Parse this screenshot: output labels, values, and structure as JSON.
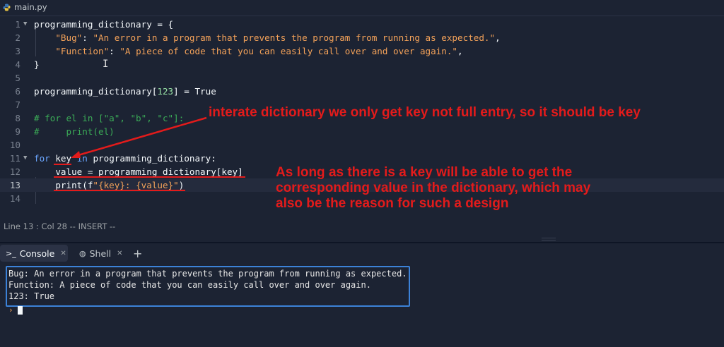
{
  "file_tab": {
    "filename": "main.py",
    "icon": "python-icon"
  },
  "editor": {
    "lines": [
      {
        "n": "1",
        "t": "programming_dictionary = {"
      },
      {
        "n": "2",
        "key": "\"Bug\"",
        "val": "\"An error in a program that prevents the program from running as expected.\""
      },
      {
        "n": "3",
        "key": "\"Function\"",
        "val": "\"A piece of code that you can easily call over and over again.\""
      },
      {
        "n": "4",
        "t": "}"
      },
      {
        "n": "5"
      },
      {
        "n": "6",
        "a": "programming_dictionary[",
        "num": "123",
        "b": "] = True"
      },
      {
        "n": "7"
      },
      {
        "n": "8",
        "t": "# for el in [\"a\", \"b\", \"c\"]:"
      },
      {
        "n": "9",
        "t": "#     print(el)"
      },
      {
        "n": "10"
      },
      {
        "n": "11",
        "kw1": "for",
        "var": "key",
        "kw2": "in",
        "rest": "programming_dictionary:"
      },
      {
        "n": "12",
        "t": "value = programming_dictionary[key]"
      },
      {
        "n": "13",
        "fn": "print(f",
        "s": "\"{key}: {value}\"",
        "close": ")"
      },
      {
        "n": "14"
      }
    ]
  },
  "annotations": {
    "first": "interate dictionary we only get key not full entry, so it should be key",
    "second_lines": [
      "As long as there is a key will be able to get the",
      "corresponding value in the dictionary, which may",
      "also be the reason for such a design"
    ],
    "color": "#e31b1b"
  },
  "status": {
    "text": "Line 13 : Col 28  -- INSERT --"
  },
  "panel": {
    "tabs": [
      {
        "label": "Console",
        "icon": "terminal-icon"
      },
      {
        "label": "Shell",
        "icon": "shell-icon"
      }
    ],
    "add_tab": "+",
    "output": [
      "Bug: An error in a program that prevents the program from running as expected.",
      "Function: A piece of code that you can easily call over and over again.",
      "123: True"
    ],
    "prompt": "›"
  }
}
